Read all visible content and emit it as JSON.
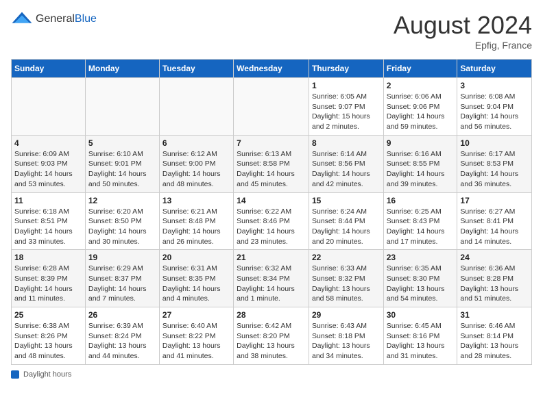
{
  "header": {
    "logo_general": "General",
    "logo_blue": "Blue",
    "month_year": "August 2024",
    "location": "Epfig, France"
  },
  "weekdays": [
    "Sunday",
    "Monday",
    "Tuesday",
    "Wednesday",
    "Thursday",
    "Friday",
    "Saturday"
  ],
  "legend": {
    "label": "Daylight hours"
  },
  "weeks": [
    [
      {
        "day": "",
        "info": ""
      },
      {
        "day": "",
        "info": ""
      },
      {
        "day": "",
        "info": ""
      },
      {
        "day": "",
        "info": ""
      },
      {
        "day": "1",
        "info": "Sunrise: 6:05 AM\nSunset: 9:07 PM\nDaylight: 15 hours\nand 2 minutes."
      },
      {
        "day": "2",
        "info": "Sunrise: 6:06 AM\nSunset: 9:06 PM\nDaylight: 14 hours\nand 59 minutes."
      },
      {
        "day": "3",
        "info": "Sunrise: 6:08 AM\nSunset: 9:04 PM\nDaylight: 14 hours\nand 56 minutes."
      }
    ],
    [
      {
        "day": "4",
        "info": "Sunrise: 6:09 AM\nSunset: 9:03 PM\nDaylight: 14 hours\nand 53 minutes."
      },
      {
        "day": "5",
        "info": "Sunrise: 6:10 AM\nSunset: 9:01 PM\nDaylight: 14 hours\nand 50 minutes."
      },
      {
        "day": "6",
        "info": "Sunrise: 6:12 AM\nSunset: 9:00 PM\nDaylight: 14 hours\nand 48 minutes."
      },
      {
        "day": "7",
        "info": "Sunrise: 6:13 AM\nSunset: 8:58 PM\nDaylight: 14 hours\nand 45 minutes."
      },
      {
        "day": "8",
        "info": "Sunrise: 6:14 AM\nSunset: 8:56 PM\nDaylight: 14 hours\nand 42 minutes."
      },
      {
        "day": "9",
        "info": "Sunrise: 6:16 AM\nSunset: 8:55 PM\nDaylight: 14 hours\nand 39 minutes."
      },
      {
        "day": "10",
        "info": "Sunrise: 6:17 AM\nSunset: 8:53 PM\nDaylight: 14 hours\nand 36 minutes."
      }
    ],
    [
      {
        "day": "11",
        "info": "Sunrise: 6:18 AM\nSunset: 8:51 PM\nDaylight: 14 hours\nand 33 minutes."
      },
      {
        "day": "12",
        "info": "Sunrise: 6:20 AM\nSunset: 8:50 PM\nDaylight: 14 hours\nand 30 minutes."
      },
      {
        "day": "13",
        "info": "Sunrise: 6:21 AM\nSunset: 8:48 PM\nDaylight: 14 hours\nand 26 minutes."
      },
      {
        "day": "14",
        "info": "Sunrise: 6:22 AM\nSunset: 8:46 PM\nDaylight: 14 hours\nand 23 minutes."
      },
      {
        "day": "15",
        "info": "Sunrise: 6:24 AM\nSunset: 8:44 PM\nDaylight: 14 hours\nand 20 minutes."
      },
      {
        "day": "16",
        "info": "Sunrise: 6:25 AM\nSunset: 8:43 PM\nDaylight: 14 hours\nand 17 minutes."
      },
      {
        "day": "17",
        "info": "Sunrise: 6:27 AM\nSunset: 8:41 PM\nDaylight: 14 hours\nand 14 minutes."
      }
    ],
    [
      {
        "day": "18",
        "info": "Sunrise: 6:28 AM\nSunset: 8:39 PM\nDaylight: 14 hours\nand 11 minutes."
      },
      {
        "day": "19",
        "info": "Sunrise: 6:29 AM\nSunset: 8:37 PM\nDaylight: 14 hours\nand 7 minutes."
      },
      {
        "day": "20",
        "info": "Sunrise: 6:31 AM\nSunset: 8:35 PM\nDaylight: 14 hours\nand 4 minutes."
      },
      {
        "day": "21",
        "info": "Sunrise: 6:32 AM\nSunset: 8:34 PM\nDaylight: 14 hours\nand 1 minute."
      },
      {
        "day": "22",
        "info": "Sunrise: 6:33 AM\nSunset: 8:32 PM\nDaylight: 13 hours\nand 58 minutes."
      },
      {
        "day": "23",
        "info": "Sunrise: 6:35 AM\nSunset: 8:30 PM\nDaylight: 13 hours\nand 54 minutes."
      },
      {
        "day": "24",
        "info": "Sunrise: 6:36 AM\nSunset: 8:28 PM\nDaylight: 13 hours\nand 51 minutes."
      }
    ],
    [
      {
        "day": "25",
        "info": "Sunrise: 6:38 AM\nSunset: 8:26 PM\nDaylight: 13 hours\nand 48 minutes."
      },
      {
        "day": "26",
        "info": "Sunrise: 6:39 AM\nSunset: 8:24 PM\nDaylight: 13 hours\nand 44 minutes."
      },
      {
        "day": "27",
        "info": "Sunrise: 6:40 AM\nSunset: 8:22 PM\nDaylight: 13 hours\nand 41 minutes."
      },
      {
        "day": "28",
        "info": "Sunrise: 6:42 AM\nSunset: 8:20 PM\nDaylight: 13 hours\nand 38 minutes."
      },
      {
        "day": "29",
        "info": "Sunrise: 6:43 AM\nSunset: 8:18 PM\nDaylight: 13 hours\nand 34 minutes."
      },
      {
        "day": "30",
        "info": "Sunrise: 6:45 AM\nSunset: 8:16 PM\nDaylight: 13 hours\nand 31 minutes."
      },
      {
        "day": "31",
        "info": "Sunrise: 6:46 AM\nSunset: 8:14 PM\nDaylight: 13 hours\nand 28 minutes."
      }
    ]
  ]
}
